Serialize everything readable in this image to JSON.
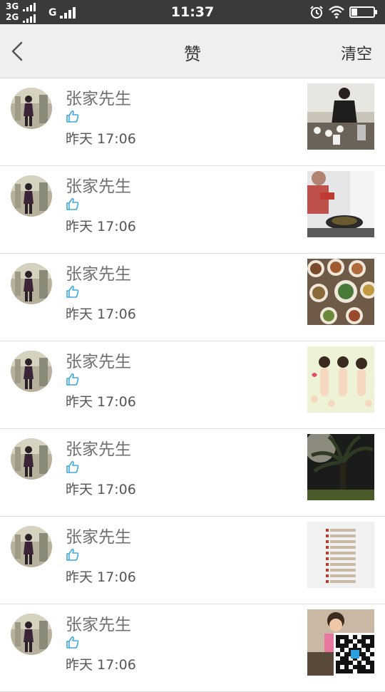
{
  "status_bar": {
    "network_top": "3G",
    "network_bottom": "2G",
    "network_mid": "G",
    "time": "11:37"
  },
  "header": {
    "title": "赞",
    "clear_label": "清空"
  },
  "colors": {
    "like_icon": "#3fa9e0",
    "statusbar_bg": "#3a3a3a",
    "navbar_bg": "#efefef"
  },
  "icons": {
    "back": "chevron-left-icon",
    "like": "thumbs-up-icon",
    "alarm": "alarm-icon",
    "wifi": "wifi-icon",
    "battery": "battery-icon"
  },
  "items": [
    {
      "name": "张家先生",
      "time": "昨天 17:06",
      "thumb": "person-cooking-table"
    },
    {
      "name": "张家先生",
      "time": "昨天 17:06",
      "thumb": "person-cooking-wok"
    },
    {
      "name": "张家先生",
      "time": "昨天 17:06",
      "thumb": "dishes-on-table"
    },
    {
      "name": "张家先生",
      "time": "昨天 17:06",
      "thumb": "cartoon-women"
    },
    {
      "name": "张家先生",
      "time": "昨天 17:06",
      "thumb": "palm-tree-sunset"
    },
    {
      "name": "张家先生",
      "time": "昨天 17:06",
      "thumb": "text-list-screenshot"
    },
    {
      "name": "张家先生",
      "time": "昨天 17:06",
      "thumb": "child-photo-with-qr"
    }
  ]
}
